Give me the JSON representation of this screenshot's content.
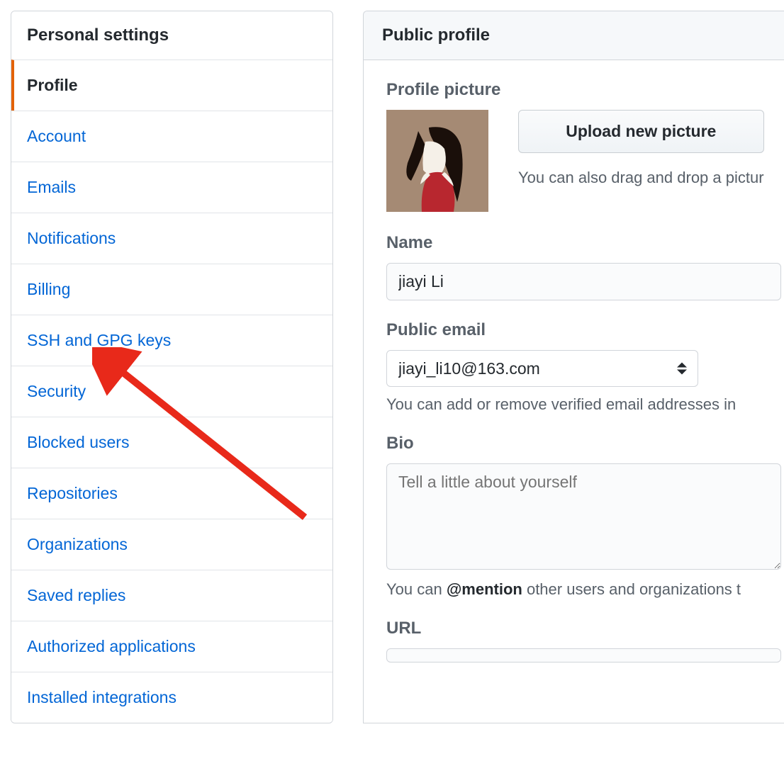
{
  "sidebar": {
    "header": "Personal settings",
    "items": [
      {
        "label": "Profile",
        "active": true
      },
      {
        "label": "Account",
        "active": false
      },
      {
        "label": "Emails",
        "active": false
      },
      {
        "label": "Notifications",
        "active": false
      },
      {
        "label": "Billing",
        "active": false
      },
      {
        "label": "SSH and GPG keys",
        "active": false
      },
      {
        "label": "Security",
        "active": false
      },
      {
        "label": "Blocked users",
        "active": false
      },
      {
        "label": "Repositories",
        "active": false
      },
      {
        "label": "Organizations",
        "active": false
      },
      {
        "label": "Saved replies",
        "active": false
      },
      {
        "label": "Authorized applications",
        "active": false
      },
      {
        "label": "Installed integrations",
        "active": false
      }
    ]
  },
  "main": {
    "header": "Public profile",
    "profile_picture": {
      "label": "Profile picture",
      "upload_button": "Upload new picture",
      "drag_hint": "You can also drag and drop a pictur"
    },
    "name": {
      "label": "Name",
      "value": "jiayi Li"
    },
    "public_email": {
      "label": "Public email",
      "selected": "jiayi_li10@163.com",
      "hint": "You can add or remove verified email addresses in "
    },
    "bio": {
      "label": "Bio",
      "placeholder": "Tell a little about yourself",
      "value": "",
      "hint_prefix": "You can ",
      "hint_mention": "@mention",
      "hint_suffix": " other users and organizations t"
    },
    "url": {
      "label": "URL"
    }
  },
  "annotation": {
    "target": "SSH and GPG keys"
  }
}
